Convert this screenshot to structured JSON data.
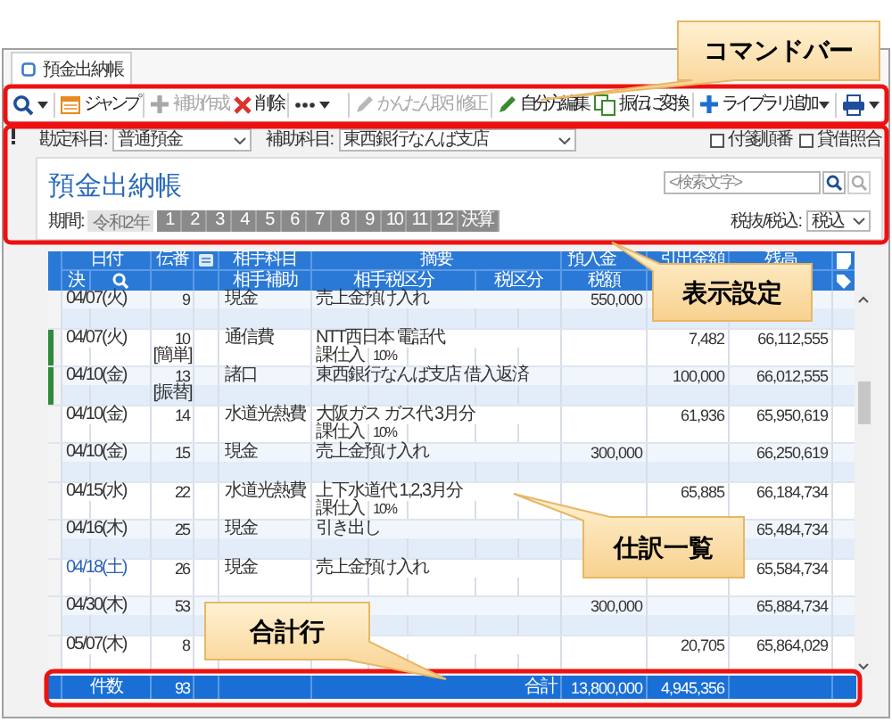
{
  "tab": {
    "title": "預金出納帳"
  },
  "toolbar": [
    {
      "kind": "search",
      "caret": true,
      "disabled": false
    },
    {
      "kind": "calendar",
      "label": "ジャンプ",
      "caret": false,
      "disabled": false
    },
    {
      "kind": "plus",
      "label": "補助作成",
      "caret": false,
      "disabled": true
    },
    {
      "kind": "cross",
      "label": "削除",
      "caret": false,
      "disabled": false
    },
    {
      "kind": "more",
      "caret": true,
      "disabled": false
    },
    {
      "kind": "pencil",
      "label": "かんたん取引修正",
      "caret": false,
      "disabled": true
    },
    {
      "kind": "pencil",
      "label": "自分方編集",
      "caret": false,
      "disabled": false
    },
    {
      "kind": "copy",
      "label": "振伝に変換",
      "caret": false,
      "disabled": false
    },
    {
      "kind": "plus",
      "label": "ライブラリ追加",
      "caret": true,
      "disabled": false
    },
    {
      "kind": "print",
      "caret": true,
      "disabled": false
    }
  ],
  "options": {
    "account": {
      "label": "勘定科目:",
      "value": "普通預金"
    },
    "sub_account": {
      "label": "補助科目:",
      "value": "東西銀行なんば支店"
    },
    "checkboxes": [
      {
        "label": "付箋順番",
        "checked": false
      },
      {
        "label": "貸借照合",
        "checked": false
      }
    ]
  },
  "panel": {
    "title": "預金出納帳",
    "search": {
      "placeholder": "<検索文字>"
    },
    "period": {
      "label": "期間:",
      "year": "令和2年",
      "months": [
        "1",
        "2",
        "3",
        "4",
        "5",
        "6",
        "7",
        "8",
        "9",
        "10",
        "11",
        "12",
        "決算"
      ]
    },
    "tax": {
      "label": "税抜/税込:",
      "value": "税込"
    }
  },
  "table": {
    "header": {
      "date": "日付",
      "number": "伝番",
      "account": "相手科目",
      "summary": "摘要",
      "deposit": "預入金",
      "withdrawal": "引出金額",
      "balance": "残高",
      "settle": "決",
      "sub_account": "相手補助",
      "partner_tax": "相手税区分",
      "tax": "税区分",
      "tax_amount": "税額"
    },
    "rows": [
      {
        "date": "04/07(火)",
        "color": "#333333",
        "number": "9",
        "account": "現金",
        "summary": "売上金預け入れ",
        "deposit": "550,000",
        "flagged": false
      },
      {
        "date": "04/07(火)",
        "color": "#333333",
        "number": "10",
        "account": "通信費",
        "summary": "NTT西日本 電話代",
        "tag": "[簡単]",
        "tax": "課仕入",
        "rate": "10%",
        "withdrawal": "7,482",
        "balance": "66,112,555",
        "flagged": true
      },
      {
        "date": "04/10(金)",
        "color": "#333333",
        "number": "13",
        "account": "諸口",
        "summary": "東西銀行なんば支店 借入返済",
        "tag": "[振替]",
        "withdrawal": "100,000",
        "balance": "66,012,555",
        "flagged": true
      },
      {
        "date": "04/10(金)",
        "color": "#333333",
        "number": "14",
        "account": "水道光熱費",
        "summary": "大阪ガス ガス代 3月分",
        "tax": "課仕入",
        "rate": "10%",
        "withdrawal": "61,936",
        "balance": "65,950,619",
        "flagged": false
      },
      {
        "date": "04/10(金)",
        "color": "#333333",
        "number": "15",
        "account": "現金",
        "summary": "売上金預け入れ",
        "deposit": "300,000",
        "balance": "66,250,619",
        "flagged": false
      },
      {
        "date": "04/15(水)",
        "color": "#333333",
        "number": "22",
        "account": "水道光熱費",
        "summary": "上下水道代 1,2,3月分",
        "tax": "課仕入",
        "rate": "10%",
        "withdrawal": "65,885",
        "balance": "66,184,734",
        "flagged": false
      },
      {
        "date": "04/16(木)",
        "color": "#333333",
        "number": "25",
        "account": "現金",
        "summary": "引き出し",
        "balance": "65,484,734",
        "flagged": false
      },
      {
        "date": "04/18(土)",
        "color": "#2a62b8",
        "number": "26",
        "account": "現金",
        "summary": "売上金預け入れ",
        "balance": "65,584,734",
        "flagged": false
      },
      {
        "date": "04/30(木)",
        "color": "#333333",
        "number": "53",
        "deposit": "300,000",
        "balance": "65,884,734",
        "flagged": false
      },
      {
        "date": "05/07(木)",
        "color": "#333333",
        "number": "8",
        "withdrawal": "20,705",
        "balance": "65,864,029",
        "flagged": false
      }
    ],
    "total": {
      "count_label": "件数",
      "count": "93",
      "total_label": "合計",
      "deposit": "13,800,000",
      "withdrawal": "4,945,356"
    }
  },
  "callouts": [
    {
      "text": "コマンドバー"
    },
    {
      "text": "表示設定"
    },
    {
      "text": "仕訳一覧"
    },
    {
      "text": "合計行"
    }
  ]
}
